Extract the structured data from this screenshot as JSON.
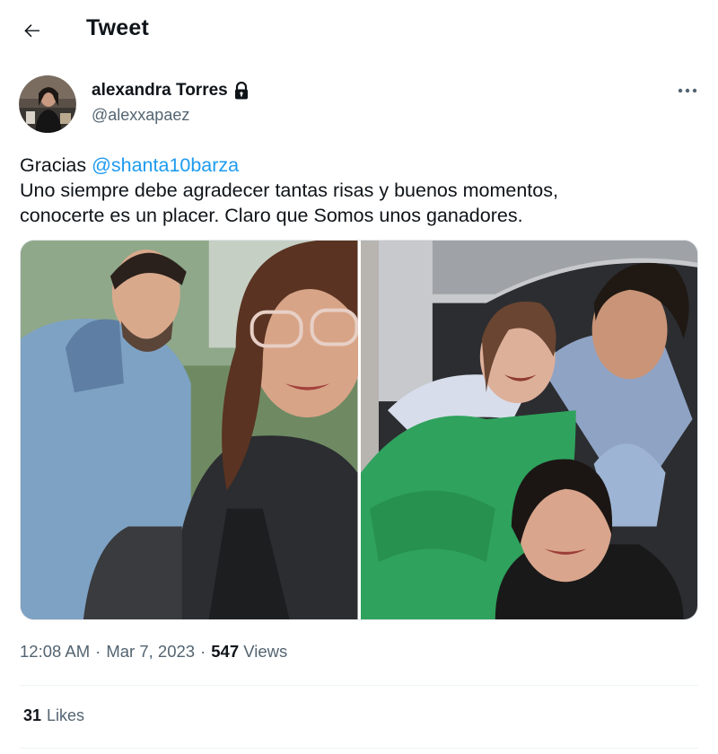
{
  "header": {
    "title": "Tweet",
    "back_icon": "arrow-left-icon"
  },
  "author": {
    "display_name": "alexandra Torres",
    "handle": "@alexxapaez",
    "protected_icon": "lock-icon"
  },
  "tweet": {
    "line1_prefix": "Gracias ",
    "mention": "@shanta10barza",
    "line2": "Uno siempre debe agradecer tantas  risas y buenos momentos,",
    "line3": "conocerte es un placer. Claro que Somos unos ganadores."
  },
  "meta": {
    "time": "12:08 AM",
    "sep1": "·",
    "date": "Mar 7, 2023",
    "sep2": "·",
    "views_count": "547",
    "views_label": "Views"
  },
  "stats": {
    "likes_count": "31",
    "likes_label": "Likes"
  },
  "colors": {
    "accent": "#1d9bf0",
    "muted": "#536471",
    "text": "#0f1419"
  }
}
